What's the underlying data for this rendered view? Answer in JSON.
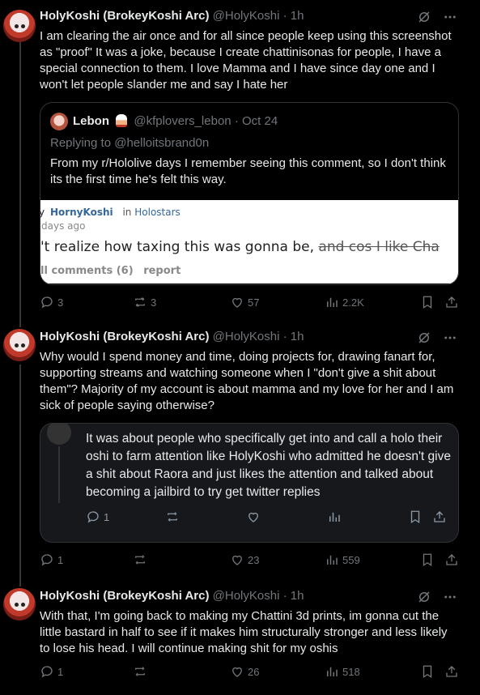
{
  "tweets": [
    {
      "name": "HolyKoshi (BrokeyKoshi Arc)",
      "handle": "@HolyKoshi",
      "time": "1h",
      "text": "I am clearing the air once and for all since people keep using this screenshot as \"proof\" It was a joke, because I create chattinisonas for people, I have a special connection to them. I love Mamma and I have since day one and I won't let people slander me and say I hate her",
      "quote": {
        "name": "Lebon",
        "handle": "@kfplovers_lebon",
        "date": "Oct 24",
        "replying": "Replying to @helloitsbrand0n",
        "text": "From my r/Hololive days I remember seeing this comment, so I don't think its the first time he's felt this way.",
        "reddit": {
          "by": "y",
          "user": "HornyKoshi",
          "in": "in",
          "sub": "Holostars",
          "age": "days ago",
          "comment": "'t realize how taxing this was gonna be,",
          "struck": "and cos I like Cha",
          "comments": "ll comments (6)",
          "report": "report"
        }
      },
      "stats": {
        "replies": "3",
        "reposts": "3",
        "likes": "57",
        "views": "2.2K"
      }
    },
    {
      "name": "HolyKoshi (BrokeyKoshi Arc)",
      "handle": "@HolyKoshi",
      "time": "1h",
      "text": "Why would I spend money and time, doing projects for, drawing fanart for, supporting streams and watching someone when I \"don't give a shit about them\"? Majority of my account is about mamma and my love for her and I am sick of people saying otherwise?",
      "embed": {
        "text": "It was about people who specifically get into and call a holo their oshi to farm attention like HolyKoshi who admitted he doesn't give a shit about Raora and just likes the attention and talked about becoming a jailbird to try get twitter replies",
        "replies": "1"
      },
      "stats": {
        "replies": "1",
        "reposts": "",
        "likes": "23",
        "views": "559"
      }
    },
    {
      "name": "HolyKoshi (BrokeyKoshi Arc)",
      "handle": "@HolyKoshi",
      "time": "1h",
      "text": "With that, I'm going back to making my Chattini 3d prints, im gonna cut the little bastard in half to see if it makes him structurally stronger and less likely to lose his head. I will continue making shit for my oshis",
      "stats": {
        "replies": "1",
        "reposts": "",
        "likes": "26",
        "views": "518"
      }
    }
  ],
  "icons": {
    "grok": "grok-icon",
    "more": "more-icon",
    "reply": "reply-icon",
    "repost": "repost-icon",
    "like": "heart-icon",
    "views": "views-icon",
    "bookmark": "bookmark-icon",
    "share": "share-icon"
  },
  "colors": {
    "bg": "#000000",
    "text": "#e7e9ea",
    "muted": "#71767b",
    "link": "#336699"
  }
}
